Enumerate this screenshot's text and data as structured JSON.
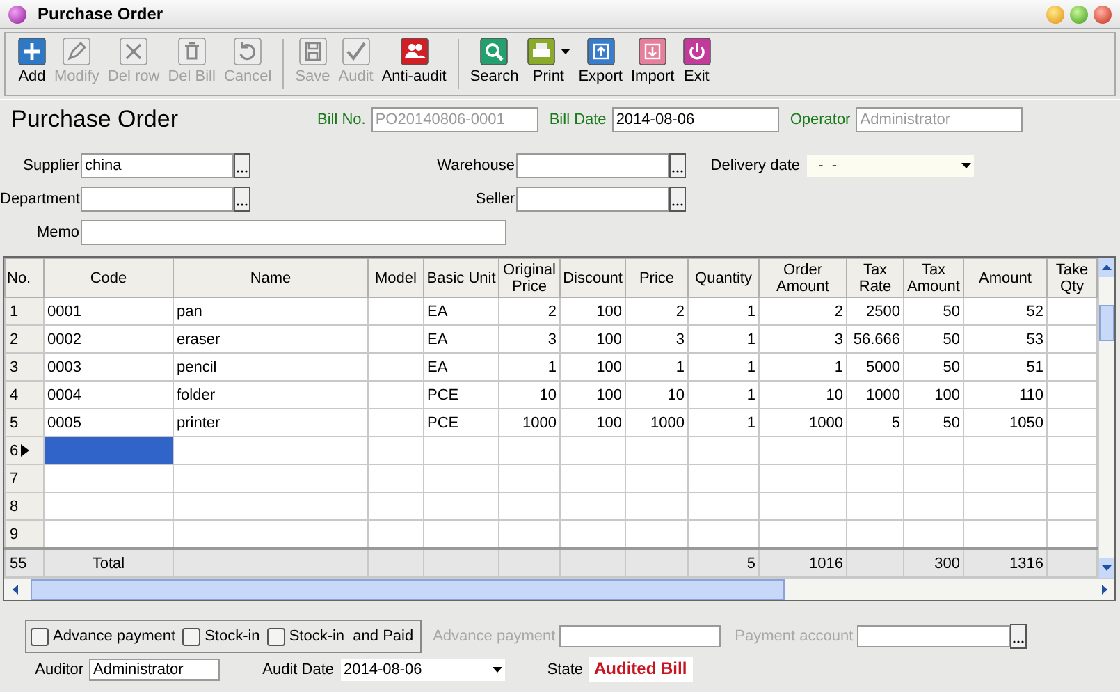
{
  "window": {
    "title": "Purchase Order"
  },
  "toolbar": [
    [
      {
        "label": "Add",
        "kind": "add",
        "disabled": false,
        "dropdown": false
      },
      {
        "label": "Modify",
        "kind": "modify",
        "disabled": true,
        "dropdown": false
      },
      {
        "label": "Del row",
        "kind": "delrow",
        "disabled": true,
        "dropdown": false
      },
      {
        "label": "Del Bill",
        "kind": "delbill",
        "disabled": true,
        "dropdown": false
      },
      {
        "label": "Cancel",
        "kind": "cancel",
        "disabled": true,
        "dropdown": false
      }
    ],
    [
      {
        "label": "Save",
        "kind": "save",
        "disabled": true,
        "dropdown": false
      },
      {
        "label": "Audit",
        "kind": "audit",
        "disabled": true,
        "dropdown": false
      },
      {
        "label": "Anti-audit",
        "kind": "antiaudit",
        "disabled": false,
        "dropdown": false
      }
    ],
    [
      {
        "label": "Search",
        "kind": "search",
        "disabled": false,
        "dropdown": false
      },
      {
        "label": "Print",
        "kind": "print",
        "disabled": false,
        "dropdown": true
      },
      {
        "label": "Export",
        "kind": "export",
        "disabled": false,
        "dropdown": false
      },
      {
        "label": "Import",
        "kind": "import",
        "disabled": false,
        "dropdown": false
      },
      {
        "label": "Exit",
        "kind": "exit",
        "disabled": false,
        "dropdown": false
      }
    ]
  ],
  "header": {
    "title": "Purchase Order",
    "fields": [
      {
        "label": "Bill No.",
        "value": "PO20140806-0001",
        "disabled": true
      },
      {
        "label": "Bill Date",
        "value": "2014-08-06",
        "disabled": false
      },
      {
        "label": "Operator",
        "value": "Administrator",
        "disabled": true
      }
    ]
  },
  "form": {
    "supplier": {
      "label": "Supplier",
      "value": "china"
    },
    "warehouse": {
      "label": "Warehouse"
    },
    "delivery_date": {
      "label": "Delivery date",
      "value": "  -  -"
    },
    "department": {
      "label": "Department"
    },
    "seller": {
      "label": "Seller"
    },
    "memo": {
      "label": "Memo"
    }
  },
  "grid": {
    "columns": [
      "No.",
      "Code",
      "Name",
      "Model",
      "Basic Unit",
      "Original Price",
      "Discount",
      "Price",
      "Quantity",
      "Order Amount",
      "Tax Rate",
      "Tax Amount",
      "Amount",
      "Take Qty"
    ],
    "rows": [
      {
        "no": "1",
        "current": false,
        "cells": [
          "0001",
          "pan",
          "",
          "EA",
          "2",
          "100",
          "2",
          "1",
          "2",
          "2500",
          "50",
          "52",
          ""
        ]
      },
      {
        "no": "2",
        "current": false,
        "cells": [
          "0002",
          "eraser",
          "",
          "EA",
          "3",
          "100",
          "3",
          "1",
          "3",
          "56.666",
          "50",
          "53",
          ""
        ]
      },
      {
        "no": "3",
        "current": false,
        "cells": [
          "0003",
          "pencil",
          "",
          "EA",
          "1",
          "100",
          "1",
          "1",
          "1",
          "5000",
          "50",
          "51",
          ""
        ]
      },
      {
        "no": "4",
        "current": false,
        "cells": [
          "0004",
          "folder",
          "",
          "PCE",
          "10",
          "100",
          "10",
          "1",
          "10",
          "1000",
          "100",
          "110",
          ""
        ]
      },
      {
        "no": "5",
        "current": false,
        "cells": [
          "0005",
          "printer",
          "",
          "PCE",
          "1000",
          "100",
          "1000",
          "1",
          "1000",
          "5",
          "50",
          "1050",
          ""
        ]
      },
      {
        "no": "6",
        "current": true
      },
      {
        "no": "7",
        "current": false
      },
      {
        "no": "8",
        "current": false
      },
      {
        "no": "9",
        "current": false
      }
    ],
    "total": {
      "no": "55",
      "cells": [
        "Total",
        "",
        "",
        "",
        "",
        "",
        "",
        "5",
        "1016",
        "",
        "300",
        "1316",
        ""
      ]
    }
  },
  "bottom": {
    "checkboxes": [
      {
        "label": "Advance payment",
        "checked": false
      },
      {
        "label": "Stock-in",
        "checked": false
      },
      {
        "label": "Stock-in  and Paid",
        "checked": false
      }
    ],
    "advance_payment": {
      "label": "Advance payment",
      "disabled": true
    },
    "payment_account": {
      "label": "Payment account",
      "disabled": true
    },
    "auditor": {
      "label": "Auditor",
      "value": "Administrator"
    },
    "audit_date": {
      "label": "Audit Date",
      "value": "2014-08-06"
    },
    "state": {
      "label": "State",
      "value": "Audited Bill"
    }
  }
}
